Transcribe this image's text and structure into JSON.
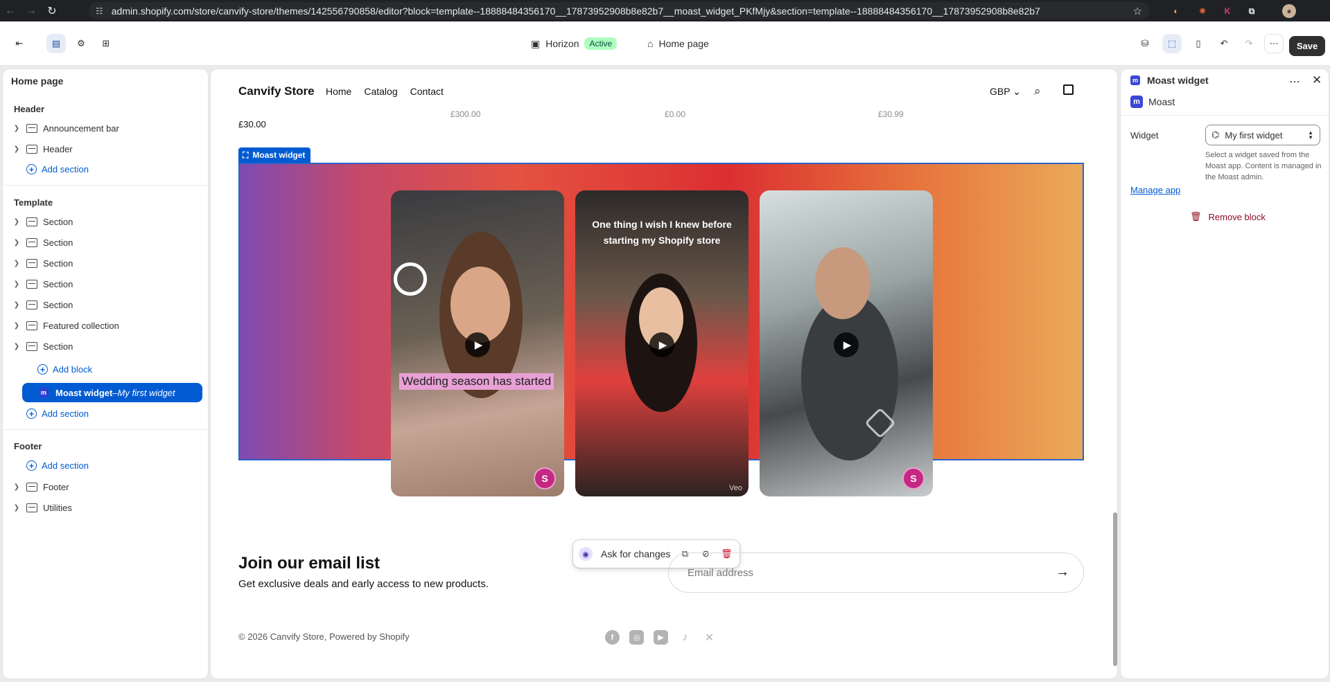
{
  "browser": {
    "url": "admin.shopify.com/store/canvify-store/themes/142556790858/editor?block=template--18888484356170__17873952908b8e82b7__moast_widget_PKfMjy&section=template--18888484356170__17873952908b8e82b7"
  },
  "topbar": {
    "theme_name": "Horizon",
    "theme_status": "Active",
    "page_name": "Home page",
    "save_label": "Save"
  },
  "sidebar": {
    "title": "Home page",
    "header_group": "Header",
    "header_items": [
      "Announcement bar",
      "Header"
    ],
    "add_section": "Add section",
    "template_group": "Template",
    "template_items": [
      "Section",
      "Section",
      "Section",
      "Section",
      "Section",
      "Featured collection",
      "Section"
    ],
    "add_block": "Add block",
    "selected_block": {
      "name": "Moast widget",
      "separator": " – ",
      "detail": "My first widget"
    },
    "footer_group": "Footer",
    "footer_items": [
      "Footer",
      "Utilities"
    ]
  },
  "preview": {
    "store_name": "Canvify Store",
    "nav": [
      "Home",
      "Catalog",
      "Contact"
    ],
    "currency": "GBP",
    "price": "£30.00",
    "faint_prices": [
      "£300.00",
      "£0.00",
      "£30.99"
    ],
    "widget_tag": "Moast widget",
    "videos": [
      {
        "caption": "Wedding season has started"
      },
      {
        "overlay": "One thing I wish I knew before starting my Shopify store",
        "watermark": "Veo"
      },
      {}
    ],
    "ask_label": "Ask for changes",
    "email_title": "Join our email list",
    "email_subtitle": "Get exclusive deals and early access to new products.",
    "email_placeholder": "Email address",
    "copyright": "© 2026 Canvify Store, Powered by Shopify",
    "socials": [
      "facebook-icon",
      "instagram-icon",
      "youtube-icon",
      "tiktok-icon",
      "x-icon"
    ]
  },
  "right_panel": {
    "title": "Moast widget",
    "app_name": "Moast",
    "widget_label": "Widget",
    "widget_value": "My first widget",
    "help_text": "Select a widget saved from the Moast app. Content is managed in the Moast admin.",
    "manage_link": "Manage app",
    "remove_label": "Remove block"
  },
  "colors": {
    "accent": "#005bd3",
    "save_bg": "#303030",
    "active_badge": "#affebf",
    "danger": "#8e0b21"
  }
}
